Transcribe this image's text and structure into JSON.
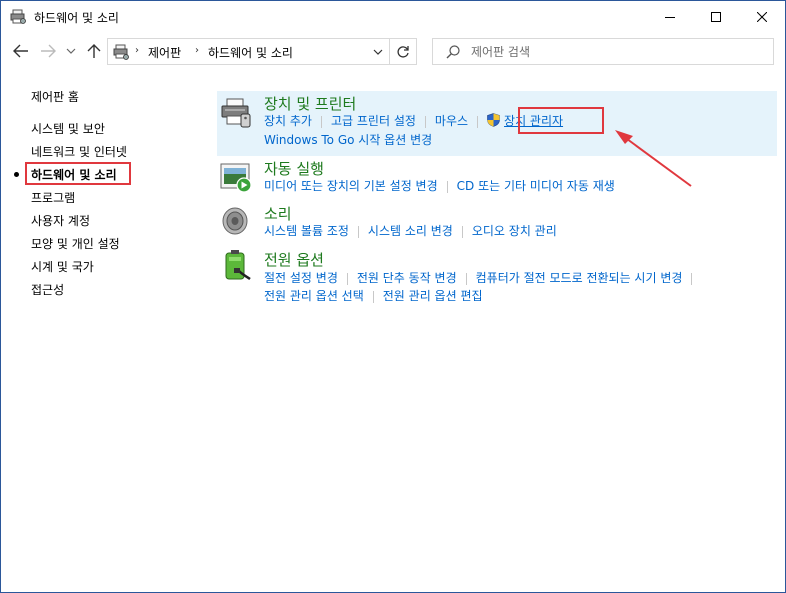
{
  "window": {
    "title": "하드웨어 및 소리"
  },
  "address": {
    "crumbs": [
      "제어판",
      "하드웨어 및 소리"
    ]
  },
  "search": {
    "placeholder": "제어판 검색"
  },
  "sidebar": {
    "home": "제어판 홈",
    "items": [
      "시스템 및 보안",
      "네트워크 및 인터넷",
      "하드웨어 및 소리",
      "프로그램",
      "사용자 계정",
      "모양 및 개인 설정",
      "시계 및 국가",
      "접근성"
    ],
    "current_index": 2
  },
  "categories": [
    {
      "title": "장치 및 프린터",
      "icon": "printer-icon",
      "links": [
        [
          "장치 추가",
          "고급 프린터 설정",
          "마우스",
          "장치 관리자"
        ],
        [
          "Windows To Go 시작 옵션 변경"
        ]
      ]
    },
    {
      "title": "자동 실행",
      "icon": "autoplay-icon",
      "links": [
        [
          "미디어 또는 장치의 기본 설정 변경",
          "CD 또는 기타 미디어 자동 재생"
        ]
      ]
    },
    {
      "title": "소리",
      "icon": "speaker-icon",
      "links": [
        [
          "시스템 볼륨 조정",
          "시스템 소리 변경",
          "오디오 장치 관리"
        ]
      ]
    },
    {
      "title": "전원 옵션",
      "icon": "battery-icon",
      "links": [
        [
          "절전 설정 변경",
          "전원 단추 동작 변경",
          "컴퓨터가 절전 모드로 전환되는 시기 변경"
        ],
        [
          "전원 관리 옵션 선택",
          "전원 관리 옵션 편집"
        ]
      ]
    }
  ],
  "colors": {
    "highlight_box": "#e0383e",
    "link": "#0066cc",
    "category_title": "#1e7a1e",
    "hover_bg": "#e5f3fb"
  }
}
